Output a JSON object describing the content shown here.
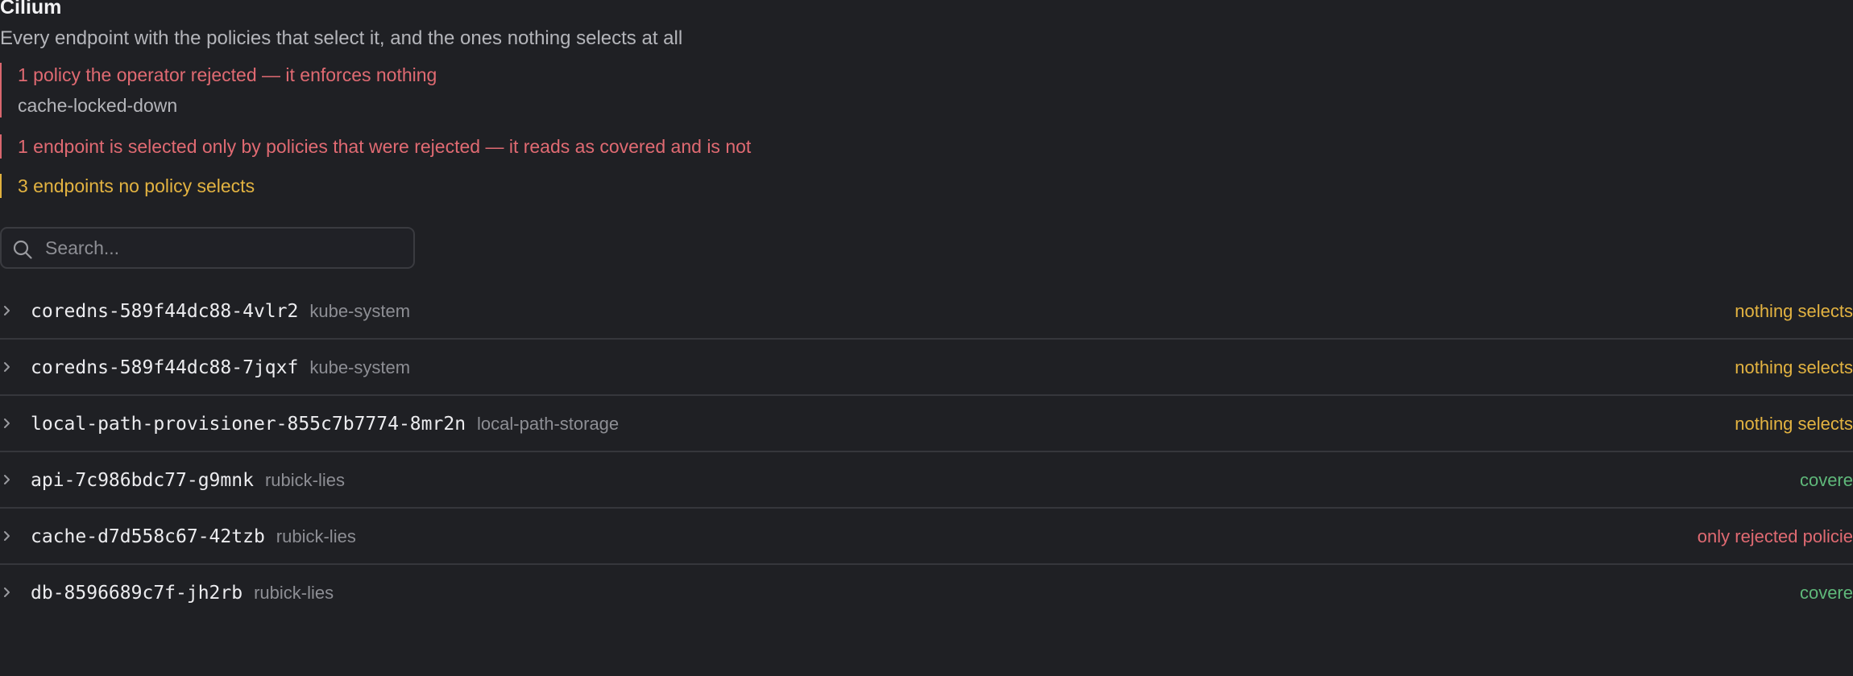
{
  "header": {
    "title": "Cilium",
    "subtitle": "Every endpoint with the policies that select it, and the ones nothing selects at all"
  },
  "alerts": [
    {
      "message": "1 policy the operator rejected — it enforces nothing",
      "detail": "cache-locked-down",
      "color": "#e06a72"
    },
    {
      "message": "1 endpoint is selected only by policies that were rejected — it reads as covered and is not",
      "color": "#e06a72"
    },
    {
      "message": "3 endpoints no policy selects",
      "color": "#e3b341"
    }
  ],
  "search": {
    "placeholder": "Search...",
    "icon": "search-icon"
  },
  "endpoints": [
    {
      "name": "coredns-589f44dc88-4vlr2",
      "namespace": "kube-system",
      "status": "nothing selects",
      "status_color": "#e3b341"
    },
    {
      "name": "coredns-589f44dc88-7jqxf",
      "namespace": "kube-system",
      "status": "nothing selects",
      "status_color": "#e3b341"
    },
    {
      "name": "local-path-provisioner-855c7b7774-8mr2n",
      "namespace": "local-path-storage",
      "status": "nothing selects",
      "status_color": "#e3b341"
    },
    {
      "name": "api-7c986bdc77-g9mnk",
      "namespace": "rubick-lies",
      "status": "covere",
      "status_color": "#5fb87a"
    },
    {
      "name": "cache-d7d558c67-42tzb",
      "namespace": "rubick-lies",
      "status": "only rejected policie",
      "status_color": "#e06a72"
    },
    {
      "name": "db-8596689c7f-jh2rb",
      "namespace": "rubick-lies",
      "status": "covere",
      "status_color": "#5fb87a"
    }
  ]
}
